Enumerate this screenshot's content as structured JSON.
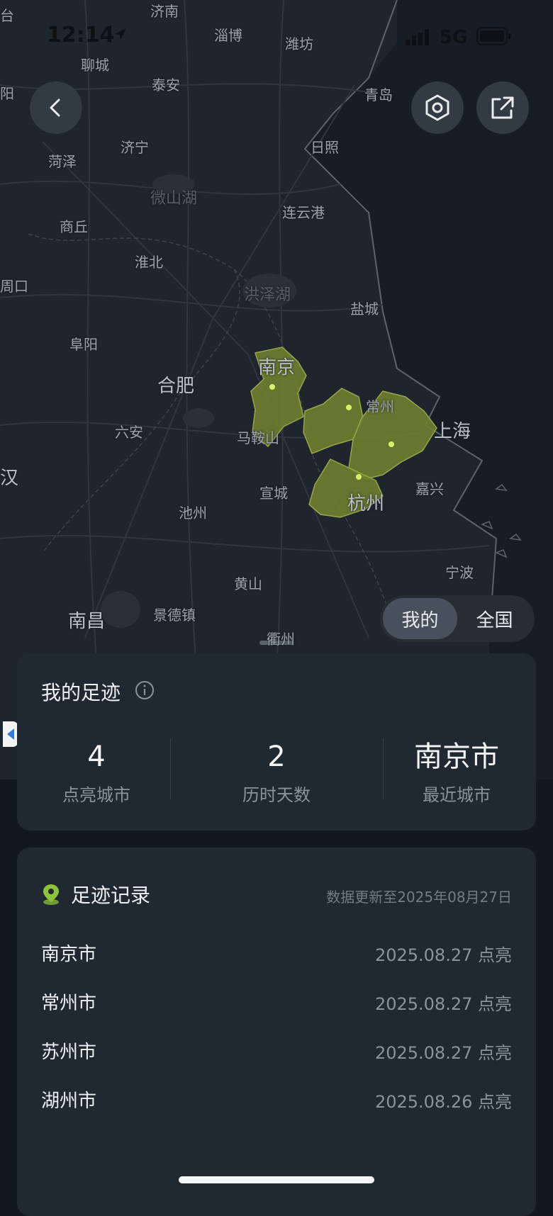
{
  "status_bar": {
    "time": "12:14",
    "network": "5G"
  },
  "map": {
    "region_color": "#6e7f2f",
    "labels": {
      "jinan": "济南",
      "zibo": "淄博",
      "weifang": "潍坊",
      "liaocheng": "聊城",
      "taian": "泰安",
      "qingdao": "青岛",
      "jining": "济宁",
      "heze": "菏泽",
      "rizhao": "日照",
      "weishanhu": "微山湖",
      "lianyungang": "连云港",
      "shangqiu": "商丘",
      "huaibei": "淮北",
      "zhoukou": "周口",
      "hongzehu": "洪泽湖",
      "yancheng": "盐城",
      "fuyang": "阜阳",
      "nanjing": "南京",
      "hefei": "合肥",
      "changzhou": "常州",
      "liuan": "六安",
      "maanshan": "马鞍山",
      "shanghai": "上海",
      "xuancheng": "宣城",
      "jiaxing": "嘉兴",
      "hangzhou": "杭州",
      "chizhou": "池州",
      "huangshan": "黄山",
      "ningbo": "宁波",
      "nanchang": "南昌",
      "jingdezhen": "景德镇",
      "quzhou": "衢州",
      "edge_tai": "台",
      "edge_yang": "阳",
      "edge_han": "汉"
    },
    "toggle": {
      "mine": "我的",
      "all": "全国"
    }
  },
  "footprint": {
    "title": "我的足迹",
    "stats": [
      {
        "value": "4",
        "label": "点亮城市"
      },
      {
        "value": "2",
        "label": "历时天数"
      },
      {
        "value": "南京市",
        "label": "最近城市"
      }
    ]
  },
  "records": {
    "title": "足迹记录",
    "updated": "数据更新至2025年08月27日",
    "items": [
      {
        "city": "南京市",
        "date": "2025.08.27 点亮"
      },
      {
        "city": "常州市",
        "date": "2025.08.27 点亮"
      },
      {
        "city": "苏州市",
        "date": "2025.08.27 点亮"
      },
      {
        "city": "湖州市",
        "date": "2025.08.26 点亮"
      }
    ]
  },
  "colors": {
    "accent_green": "#8fc23b",
    "card_bg": "#202832",
    "page_bg": "#111820"
  }
}
